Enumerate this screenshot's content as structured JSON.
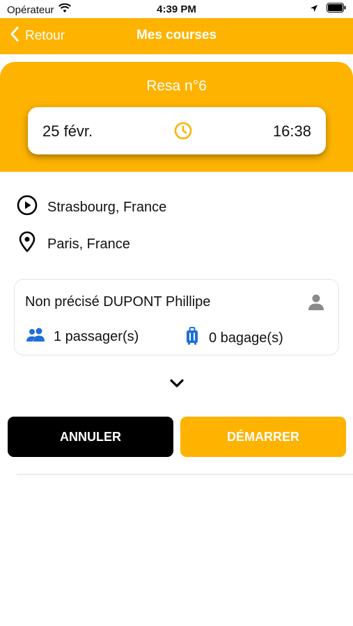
{
  "status_bar": {
    "carrier": "Opérateur",
    "time": "4:39 PM"
  },
  "nav": {
    "back_label": "Retour",
    "title": "Mes courses"
  },
  "reservation": {
    "title": "Resa n°6",
    "date": "25 févr.",
    "time": "16:38"
  },
  "route": {
    "from": "Strasbourg, France",
    "to": "Paris, France"
  },
  "passenger": {
    "name": "Non précisé DUPONT Phillipe",
    "passengers": "1 passager(s)",
    "luggage": "0 bagage(s)"
  },
  "actions": {
    "cancel_label": "ANNULER",
    "start_label": "DÉMARRER"
  },
  "colors": {
    "accent": "#FDB300",
    "cancel_bg": "#000000",
    "people_icon": "#1E6FD9",
    "person_icon": "#8A8A8A"
  },
  "icons": [
    "wifi-icon",
    "location-arrow-icon",
    "battery-icon",
    "chevron-left-icon",
    "clock-icon",
    "play-circle-icon",
    "map-pin-icon",
    "person-icon",
    "people-icon",
    "luggage-icon",
    "chevron-down-icon"
  ]
}
